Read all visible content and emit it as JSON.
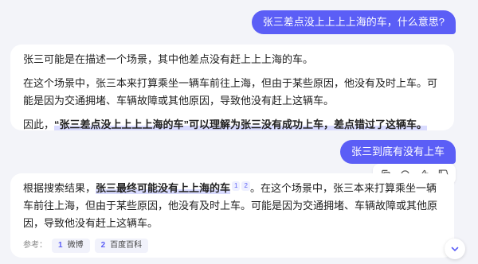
{
  "messages": {
    "user_1": "张三差点没上上上上海的车，什么意思?",
    "bot_1": {
      "p1": "张三可能是在描述一个场景，其中他差点没有赶上上上海的车。",
      "p2": "在这个场景中，张三本来打算乘坐一辆车前往上海，但由于某些原因，他没有及时上车。可能是因为交通拥堵、车辆故障或其他原因，导致他没有赶上这辆车。",
      "p3_prefix": "因此，",
      "p3_highlight": "“张三差点没上上上上海的车”可以理解为张三没有成功上车，差点错过了这辆车。"
    },
    "user_2": "张三到底有没有上车",
    "bot_2": {
      "prefix": "根据搜索结果，",
      "highlight": "张三最终可能没有上上海的车",
      "sup_1": "1",
      "sup_2": "2",
      "rest": "。在这个场景中，张三本来打算乘坐一辆车前往上海，但由于某些原因，他没有及时上车。可能是因为交通拥堵、车辆故障或其他原因，导致他没有赶上这辆车。"
    }
  },
  "references": {
    "label": "参考：",
    "items": [
      {
        "num": "1",
        "name": "微博"
      },
      {
        "num": "2",
        "name": "百度百科"
      }
    ]
  },
  "actions": [
    "copy-icon",
    "listen-icon",
    "thumbs-up-icon",
    "thumbs-down-icon"
  ],
  "colors": {
    "accent": "#5b5ef6",
    "background": "#f3f4f9",
    "highlight": "#d9dbff"
  }
}
